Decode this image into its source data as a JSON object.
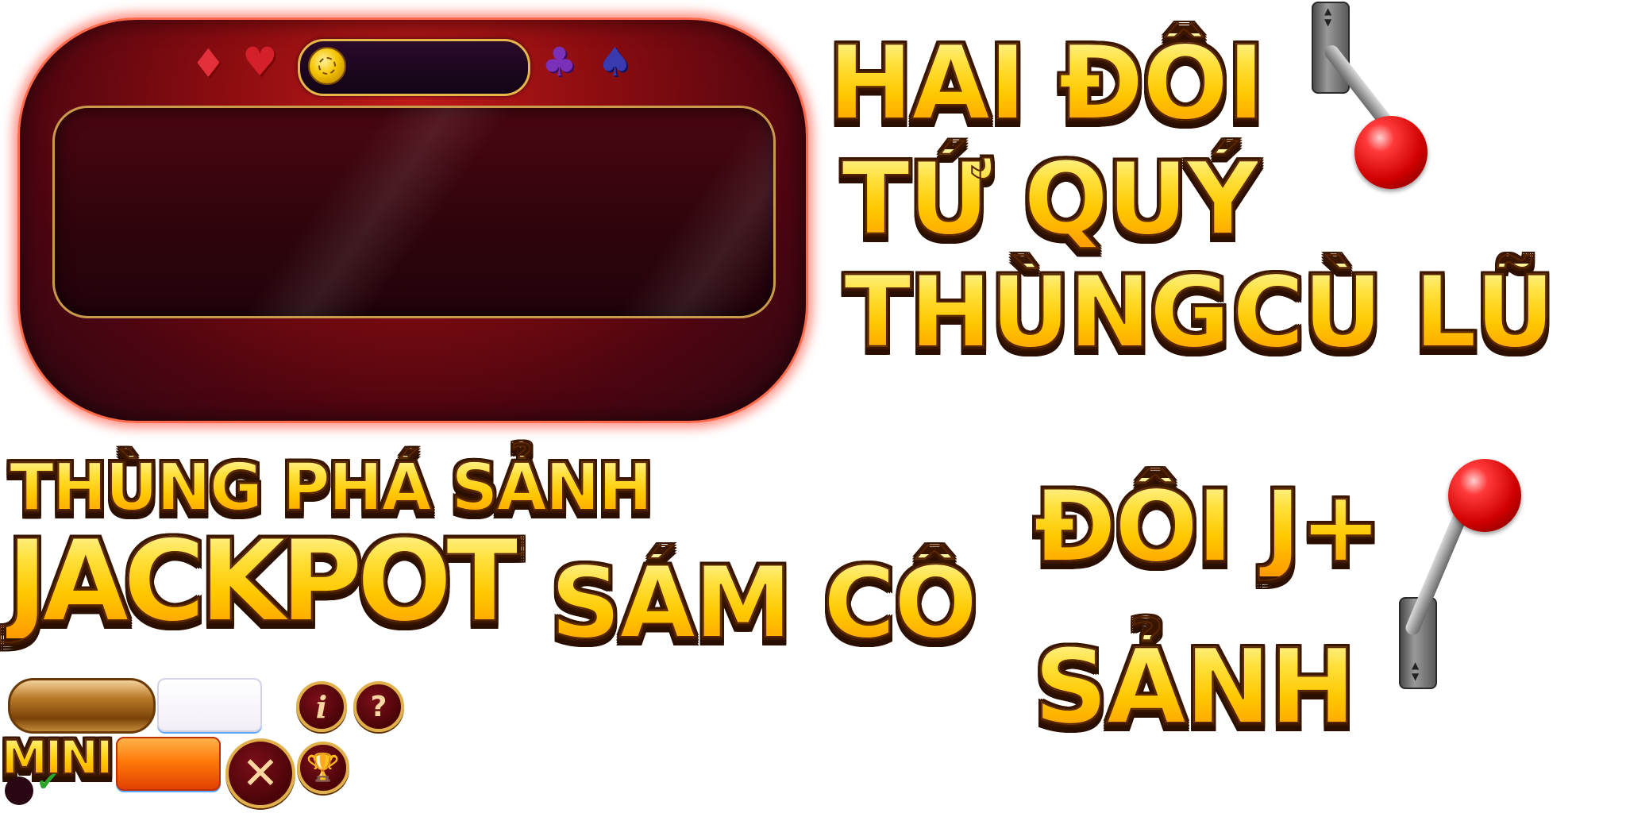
{
  "table_panel": {
    "suit_icons": [
      "diamond-icon",
      "heart-icon",
      "club-icon",
      "spade-icon"
    ],
    "jackpot_value": "",
    "colors": {
      "frame": "#8a0c10",
      "glow": "#ff3c28",
      "rim": "#c99a4a"
    }
  },
  "hand_labels": {
    "hai_doi": "HAI ĐÔI",
    "tu_quy": "TỨ QUÝ",
    "thung": "THÙNG",
    "cu_lu": "CÙ LŨ",
    "doi_j": "ĐÔI J+",
    "sanh": "SẢNH",
    "thung_pha_sanh": "THÙNG PHÁ SẢNH",
    "jackpot": "JACKPOT",
    "sam_co": "SÁM CÔ",
    "mini": "MINI"
  },
  "buttons": {
    "info_glyph": "i",
    "help_glyph": "?",
    "close_glyph": "✕",
    "trophy_glyph": "🏆",
    "check_glyph": "✔"
  },
  "lever": {
    "arrow_up": "▲",
    "arrow_down": "▼"
  },
  "colors": {
    "gold_text": "#ffcf12",
    "outline": "#3a1600",
    "lever_ball": "#d00000"
  }
}
